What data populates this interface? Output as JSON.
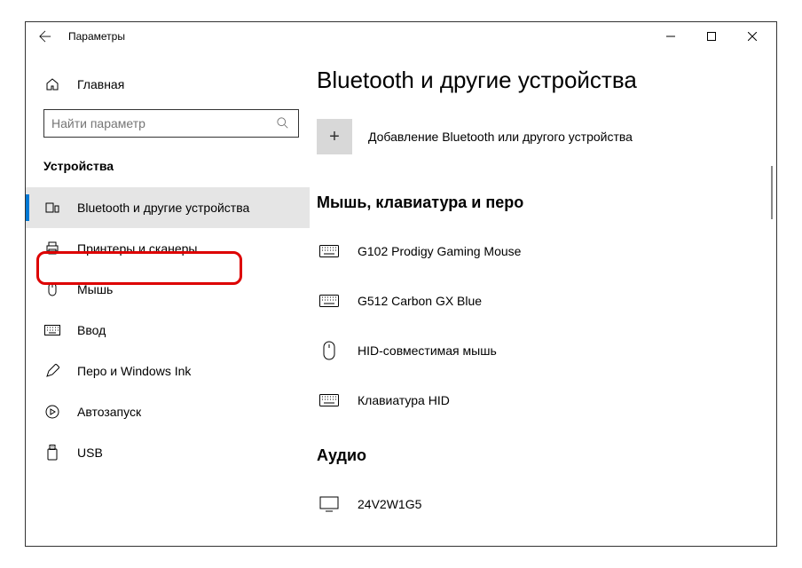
{
  "titlebar": {
    "title": "Параметры"
  },
  "sidebar": {
    "home": "Главная",
    "search_placeholder": "Найти параметр",
    "section": "Устройства",
    "items": [
      {
        "label": "Bluetooth и другие устройства"
      },
      {
        "label": "Принтеры и сканеры"
      },
      {
        "label": "Мышь"
      },
      {
        "label": "Ввод"
      },
      {
        "label": "Перо и Windows Ink"
      },
      {
        "label": "Автозапуск"
      },
      {
        "label": "USB"
      }
    ]
  },
  "main": {
    "title": "Bluetooth и другие устройства",
    "add_label": "Добавление Bluetooth или другого устройства",
    "group1_title": "Мышь, клавиатура и перо",
    "devices": [
      {
        "label": "G102 Prodigy Gaming Mouse"
      },
      {
        "label": "G512 Carbon GX Blue"
      },
      {
        "label": "HID-совместимая мышь"
      },
      {
        "label": "Клавиатура HID"
      }
    ],
    "group2_title": "Аудио",
    "audio_devices": [
      {
        "label": "24V2W1G5"
      }
    ]
  }
}
